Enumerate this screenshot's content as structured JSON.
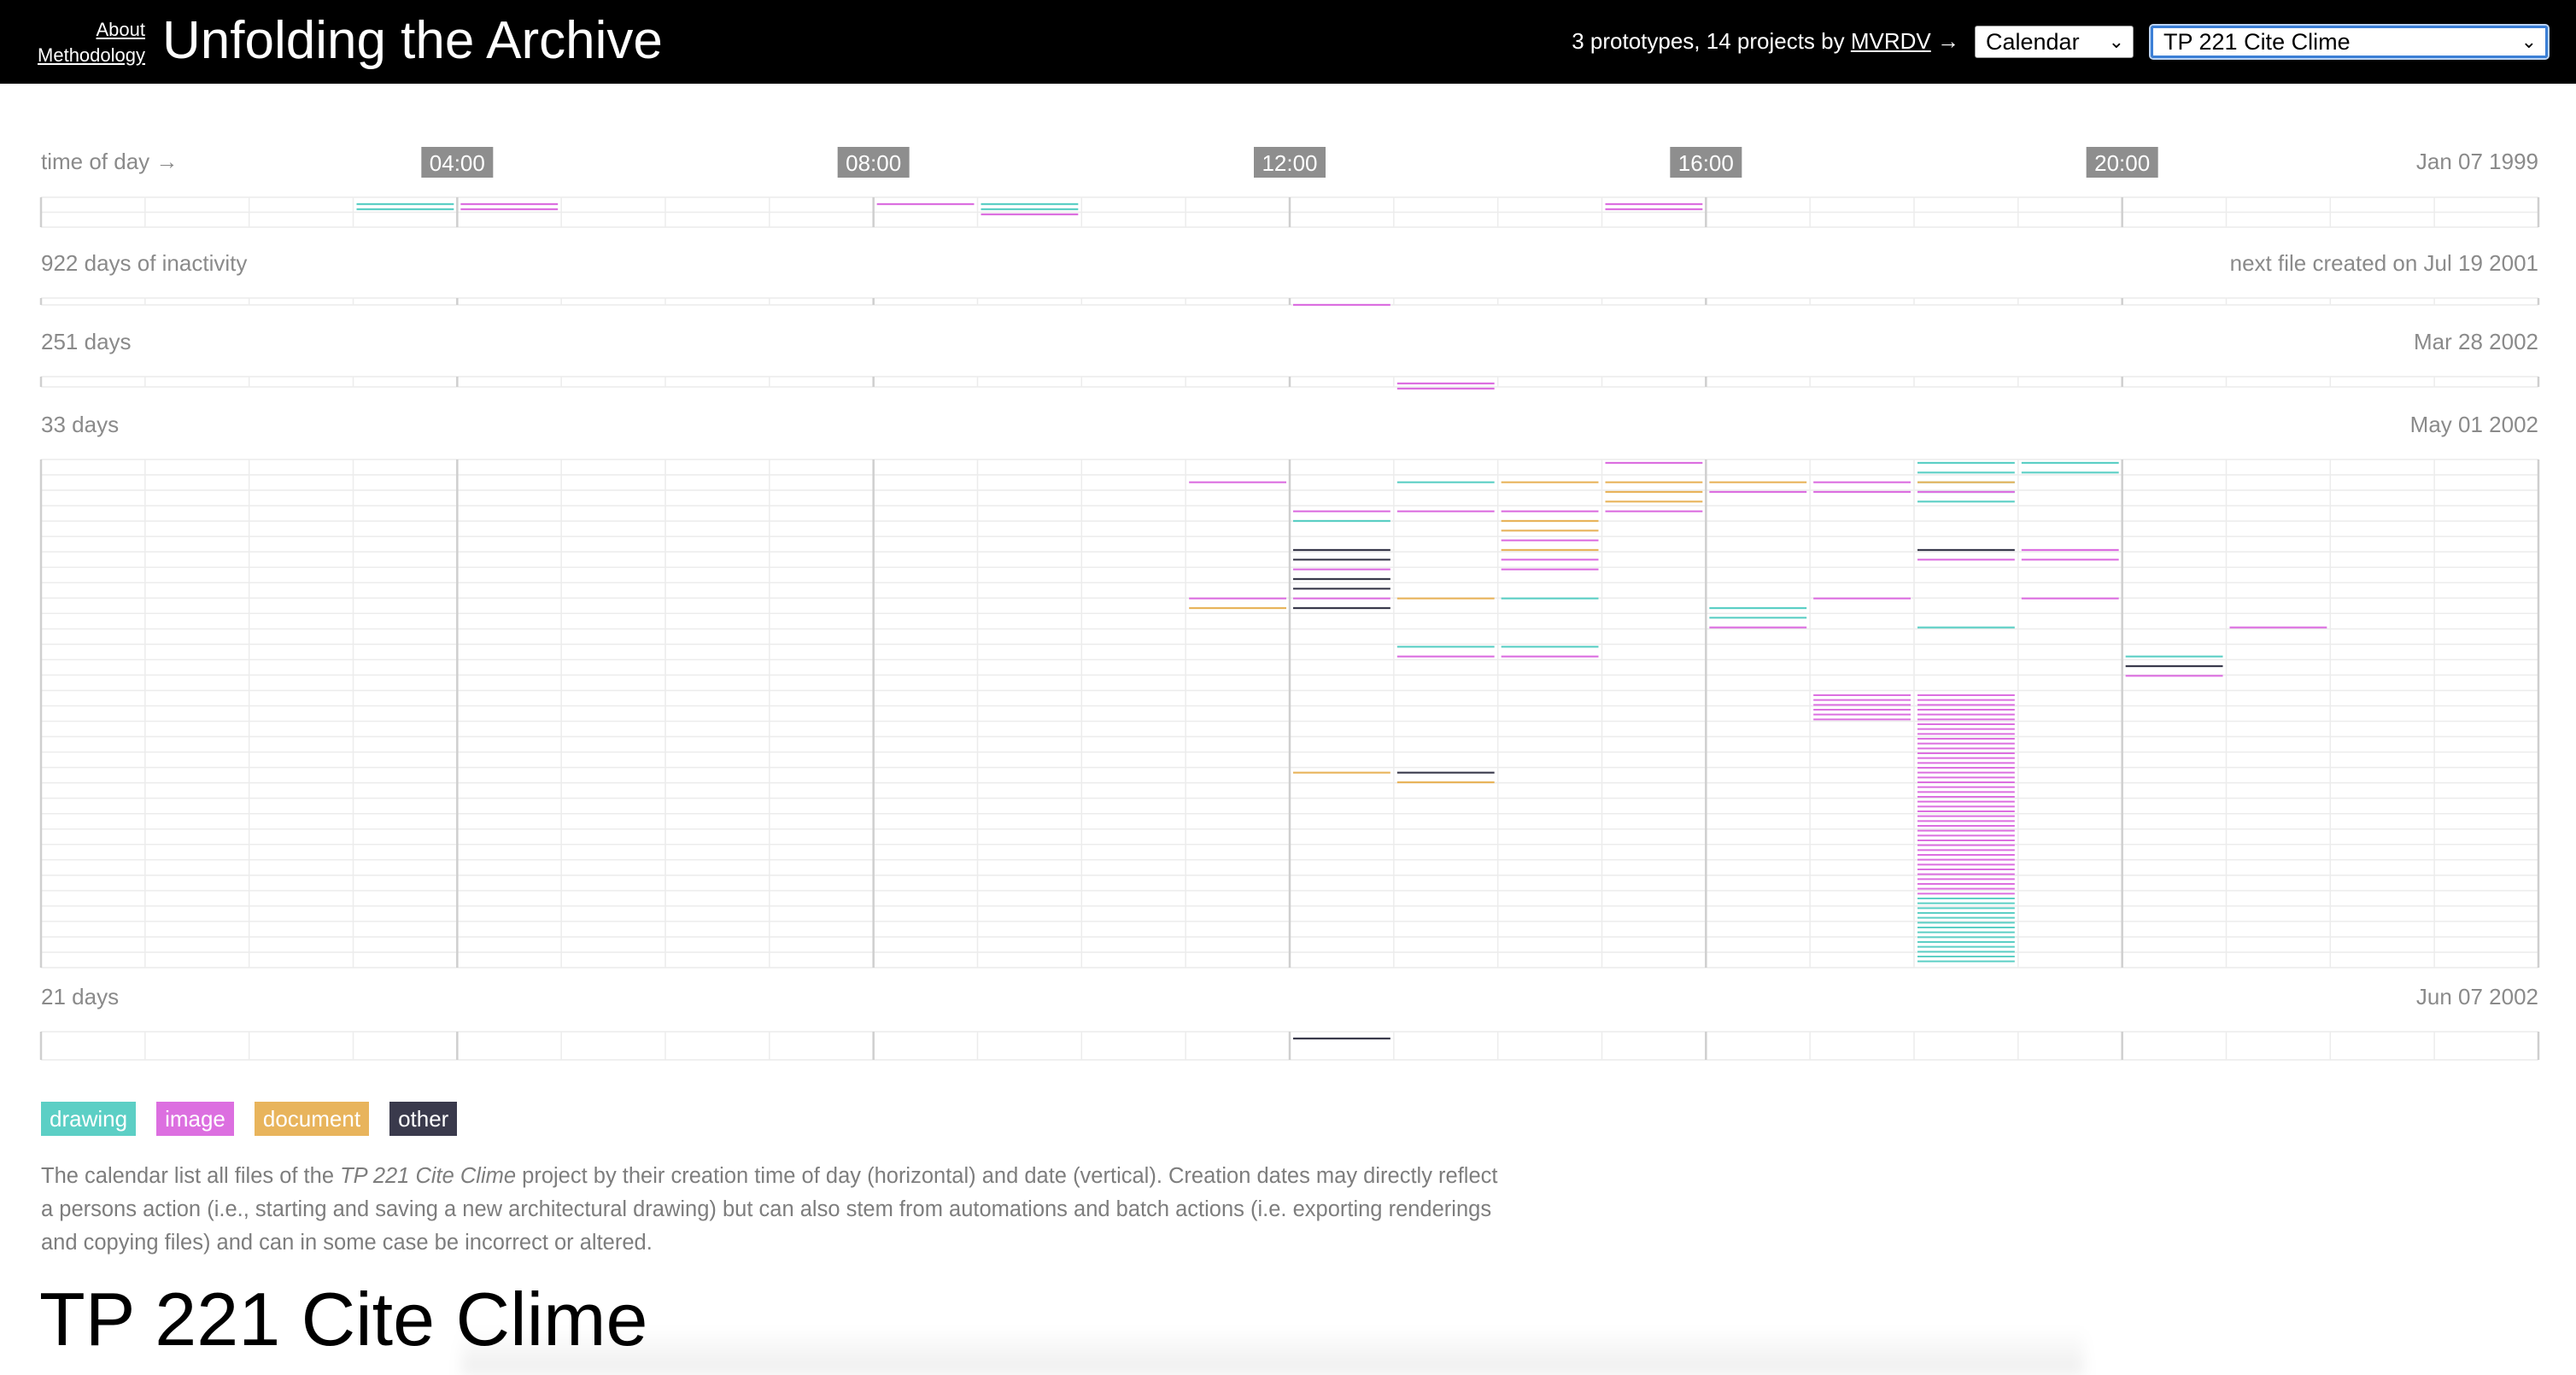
{
  "header": {
    "nav": [
      "About",
      "Methodology"
    ],
    "title": "Unfolding the Archive",
    "tagline_prefix": "3 prototypes, 14 projects by",
    "tagline_link": "MVRDV",
    "tagline_arrow": "→",
    "view_select": {
      "value": "Calendar"
    },
    "project_select": {
      "value": "TP 221 Cite Clime"
    }
  },
  "calendar": {
    "axis_label": "time of day →",
    "ticks": [
      "04:00",
      "08:00",
      "12:00",
      "16:00",
      "20:00"
    ],
    "colors": {
      "drawing": "#5ccfc5",
      "image": "#dc6fe0",
      "document": "#e8b45c",
      "other": "#3a3a4c"
    },
    "sections": [
      {
        "left": "",
        "right": "Jan 07 1999",
        "days": 2,
        "files": [
          [
            3,
            0,
            "drawing"
          ],
          [
            3,
            1,
            "drawing"
          ],
          [
            4,
            0,
            "image"
          ],
          [
            4,
            1,
            "image"
          ],
          [
            8,
            0,
            "image"
          ],
          [
            9,
            0,
            "drawing"
          ],
          [
            9,
            1,
            "drawing"
          ],
          [
            9,
            2,
            "image"
          ],
          [
            15,
            0,
            "image"
          ],
          [
            15,
            1,
            "image"
          ]
        ]
      },
      {
        "left": "922 days of inactivity",
        "right": "next file created on Jul 19 2001",
        "days": 1,
        "files": [
          [
            12,
            0,
            "image"
          ]
        ]
      },
      {
        "left": "251 days",
        "right": "Mar 28 2002",
        "days": 1,
        "files": [
          [
            13,
            0,
            "image"
          ],
          [
            13,
            1,
            "image"
          ]
        ]
      },
      {
        "left": "33 days",
        "right": "May 01 2002",
        "days": 33,
        "files": [
          [
            15,
            0,
            "image"
          ],
          [
            18,
            0,
            "drawing"
          ],
          [
            18,
            1,
            "drawing"
          ],
          [
            18,
            2,
            "drawing"
          ],
          [
            18,
            3,
            "drawing"
          ],
          [
            18,
            4,
            "drawing"
          ],
          [
            19,
            0,
            "drawing"
          ],
          [
            19,
            1,
            "drawing"
          ],
          [
            11,
            2,
            "image"
          ],
          [
            13,
            2,
            "drawing"
          ],
          [
            14,
            2,
            "document"
          ],
          [
            15,
            2,
            "document"
          ],
          [
            15,
            3,
            "document"
          ],
          [
            15,
            4,
            "document"
          ],
          [
            16,
            2,
            "document"
          ],
          [
            16,
            3,
            "image"
          ],
          [
            17,
            2,
            "image"
          ],
          [
            17,
            3,
            "image"
          ],
          [
            18,
            2,
            "document"
          ],
          [
            18,
            3,
            "image"
          ],
          [
            12,
            5,
            "image"
          ],
          [
            12,
            6,
            "drawing"
          ],
          [
            13,
            5,
            "image"
          ],
          [
            14,
            5,
            "image"
          ],
          [
            14,
            6,
            "document"
          ],
          [
            14,
            7,
            "document"
          ],
          [
            14,
            8,
            "image"
          ],
          [
            14,
            9,
            "document"
          ],
          [
            14,
            10,
            "image"
          ],
          [
            14,
            11,
            "image"
          ],
          [
            15,
            5,
            "image"
          ],
          [
            12,
            9,
            "other"
          ],
          [
            12,
            10,
            "other"
          ],
          [
            12,
            11,
            "image"
          ],
          [
            12,
            12,
            "other"
          ],
          [
            12,
            13,
            "other"
          ],
          [
            12,
            14,
            "image"
          ],
          [
            12,
            15,
            "other"
          ],
          [
            18,
            9,
            "other"
          ],
          [
            18,
            10,
            "image"
          ],
          [
            19,
            9,
            "image"
          ],
          [
            19,
            10,
            "image"
          ],
          [
            11,
            14,
            "image"
          ],
          [
            11,
            15,
            "document"
          ],
          [
            13,
            14,
            "document"
          ],
          [
            14,
            14,
            "drawing"
          ],
          [
            16,
            15,
            "drawing"
          ],
          [
            16,
            16,
            "drawing"
          ],
          [
            16,
            17,
            "image"
          ],
          [
            17,
            14,
            "image"
          ],
          [
            18,
            17,
            "drawing"
          ],
          [
            19,
            14,
            "image"
          ],
          [
            21,
            17,
            "image"
          ],
          [
            13,
            19,
            "drawing"
          ],
          [
            13,
            20,
            "image"
          ],
          [
            14,
            19,
            "drawing"
          ],
          [
            14,
            20,
            "image"
          ],
          [
            20,
            20,
            "drawing"
          ],
          [
            20,
            21,
            "other"
          ],
          [
            20,
            22,
            "image"
          ],
          [
            12,
            32,
            "document"
          ],
          [
            13,
            32,
            "other"
          ],
          [
            13,
            33,
            "document"
          ]
        ],
        "bursts": [
          [
            17,
            24,
            27,
            "image"
          ],
          [
            18,
            24,
            45,
            "image"
          ],
          [
            18,
            45,
            52,
            "drawing"
          ]
        ]
      },
      {
        "left": "21 days",
        "right": "Jun 07 2002",
        "days": 1,
        "files": [
          [
            12,
            0,
            "other"
          ]
        ]
      }
    ]
  },
  "legend": [
    {
      "label": "drawing",
      "color": "#5ccfc5"
    },
    {
      "label": "image",
      "color": "#dc6fe0"
    },
    {
      "label": "document",
      "color": "#e8b45c"
    },
    {
      "label": "other",
      "color": "#3a3a4c"
    }
  ],
  "description": {
    "part1": "The calendar list all files of the ",
    "project": "TP 221 Cite Clime",
    "part2": " project by their creation time of day (horizontal) and date (vertical). Creation dates may directly reflect a persons action (i.e., starting and saving a new architectural drawing) but can also stem from automations and batch actions (i.e. exporting renderings and copying files) and can in some case be incorrect or altered."
  },
  "project_title": "TP 221 Cite Clime"
}
